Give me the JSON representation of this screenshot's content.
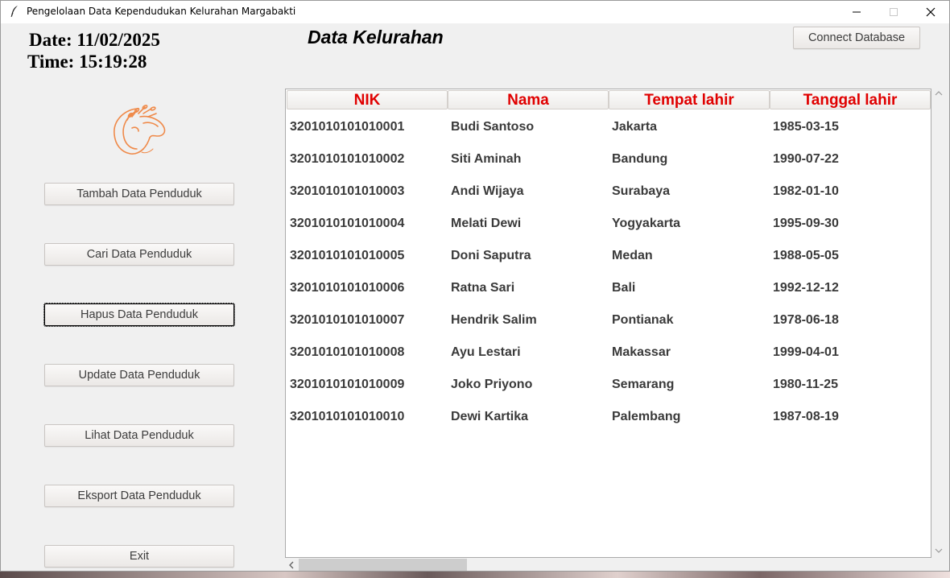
{
  "window": {
    "title": "Pengelolaan Data Kependudukan Kelurahan Margabakti"
  },
  "header": {
    "date": "Date: 11/02/2025",
    "time": "Time: 15:19:28",
    "heading": "Data Kelurahan",
    "connect_label": "Connect Database"
  },
  "sidebar": {
    "buttons": [
      {
        "label": "Tambah Data Penduduk"
      },
      {
        "label": "Cari Data Penduduk"
      },
      {
        "label": "Hapus Data Penduduk"
      },
      {
        "label": "Update Data Penduduk"
      },
      {
        "label": "Lihat Data Penduduk"
      },
      {
        "label": "Eksport Data Penduduk"
      },
      {
        "label": "Exit"
      }
    ]
  },
  "table": {
    "columns": [
      "NIK",
      "Nama",
      "Tempat lahir",
      "Tanggal lahir"
    ],
    "rows": [
      [
        "3201010101010001",
        "Budi Santoso",
        "Jakarta",
        "1985-03-15"
      ],
      [
        "3201010101010002",
        "Siti Aminah",
        "Bandung",
        "1990-07-22"
      ],
      [
        "3201010101010003",
        "Andi Wijaya",
        "Surabaya",
        "1982-01-10"
      ],
      [
        "3201010101010004",
        "Melati Dewi",
        "Yogyakarta",
        "1995-09-30"
      ],
      [
        "3201010101010005",
        "Doni Saputra",
        "Medan",
        "1988-05-05"
      ],
      [
        "3201010101010006",
        "Ratna Sari",
        "Bali",
        "1992-12-12"
      ],
      [
        "3201010101010007",
        "Hendrik Salim",
        "Pontianak",
        "1978-06-18"
      ],
      [
        "3201010101010008",
        "Ayu Lestari",
        "Makassar",
        "1999-04-01"
      ],
      [
        "3201010101010009",
        "Joko Priyono",
        "Semarang",
        "1980-11-25"
      ],
      [
        "3201010101010010",
        "Dewi Kartika",
        "Palembang",
        "1987-08-19"
      ]
    ]
  },
  "colors": {
    "header_text": "#e00000",
    "logo": "#ef8a4a"
  },
  "icons": {
    "app": "feather-icon",
    "logo": "profile-head-logo"
  }
}
